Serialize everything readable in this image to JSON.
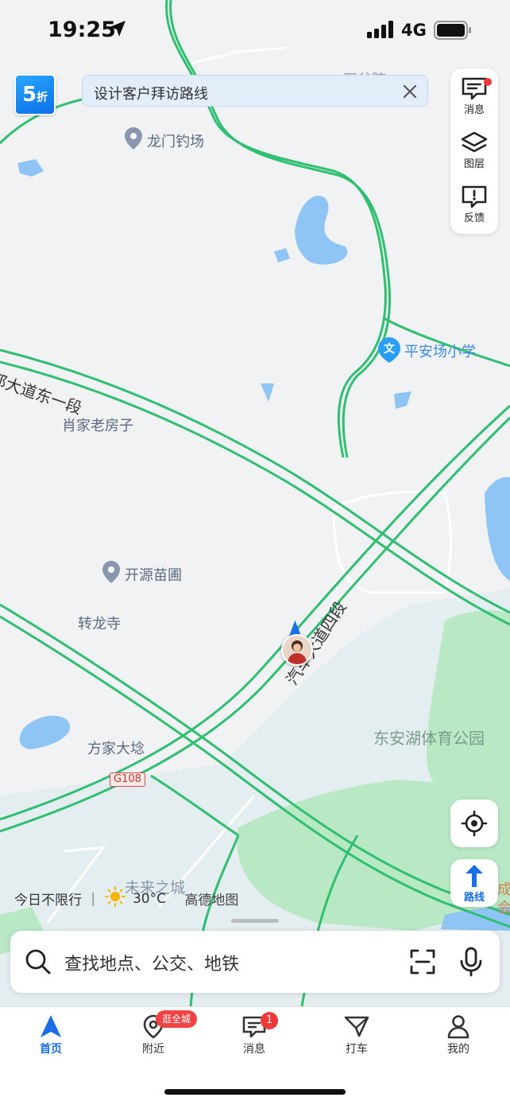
{
  "status_bar": {
    "time": "19:25",
    "network": "4G"
  },
  "promo": {
    "badge_big": "5",
    "badge_small": "折"
  },
  "search_tip": {
    "text": "设计客户拜访路线"
  },
  "side_panel": {
    "messages": "消息",
    "layers": "图层",
    "feedback": "反馈"
  },
  "map": {
    "labels": {
      "shigupu": "石谷院",
      "longmen": "龙门钓场",
      "pinganchang": "平安场小学",
      "xiaojia": "肖家老房子",
      "kaiyuan": "开源苗圃",
      "zhuanlong": "转龙寺",
      "fangjia": "方家大埝",
      "donganhu": "东安湖体育公园",
      "weilai": "未来之城",
      "cheng": "成",
      "hui": "会"
    },
    "roads": {
      "east_road": "都大道东一段",
      "si_road": "汽车大道四段",
      "g108": "G108"
    }
  },
  "weather": {
    "limit": "今日不限行",
    "separator": "|",
    "temp": "30°C",
    "brand": "高德地图"
  },
  "buttons": {
    "route": "路线"
  },
  "search": {
    "placeholder": "查找地点、公交、地铁"
  },
  "tabbar": {
    "home": "首页",
    "nearby": "附近",
    "nearby_promo": "逛全城",
    "messages": "消息",
    "messages_badge": "1",
    "taxi": "打车",
    "mine": "我的"
  },
  "colors": {
    "accent": "#1a6fe8",
    "road": "#2fbf71",
    "water": "#8ec5f5",
    "park": "#b8e8c4"
  }
}
